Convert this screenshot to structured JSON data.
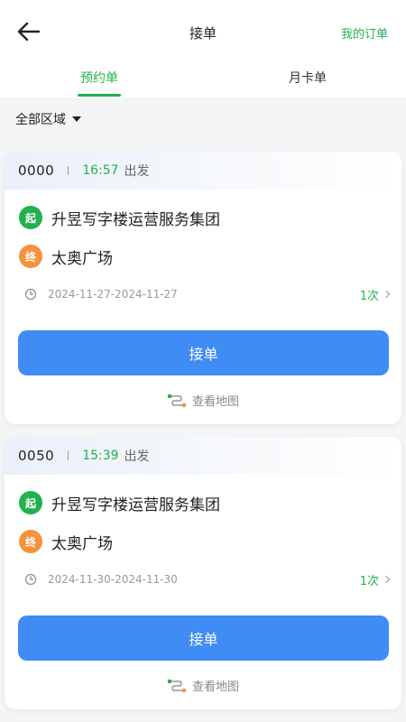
{
  "header": {
    "title": "接单",
    "my_orders": "我的订单"
  },
  "tabs": [
    {
      "label": "预约单",
      "active": true
    },
    {
      "label": "月卡单",
      "active": false
    }
  ],
  "filter": {
    "label": "全部区域"
  },
  "orders": [
    {
      "order_no": "0000",
      "time": "16:57",
      "depart_label": "出发",
      "start_badge": "起",
      "start": "升昱写字楼运营服务集团",
      "end_badge": "终",
      "end": "太奥广场",
      "date_range": "2024-11-27-2024-11-27",
      "count": "1次",
      "accept_label": "接单",
      "map_label": "查看地图"
    },
    {
      "order_no": "0050",
      "time": "15:39",
      "depart_label": "出发",
      "start_badge": "起",
      "start": "升昱写字楼运营服务集团",
      "end_badge": "终",
      "end": "太奥广场",
      "date_range": "2024-11-30-2024-11-30",
      "count": "1次",
      "accept_label": "接单",
      "map_label": "查看地图"
    }
  ],
  "colors": {
    "accent_green": "#22b14c",
    "button_blue": "#3f8cf5",
    "end_orange": "#f5923e"
  }
}
